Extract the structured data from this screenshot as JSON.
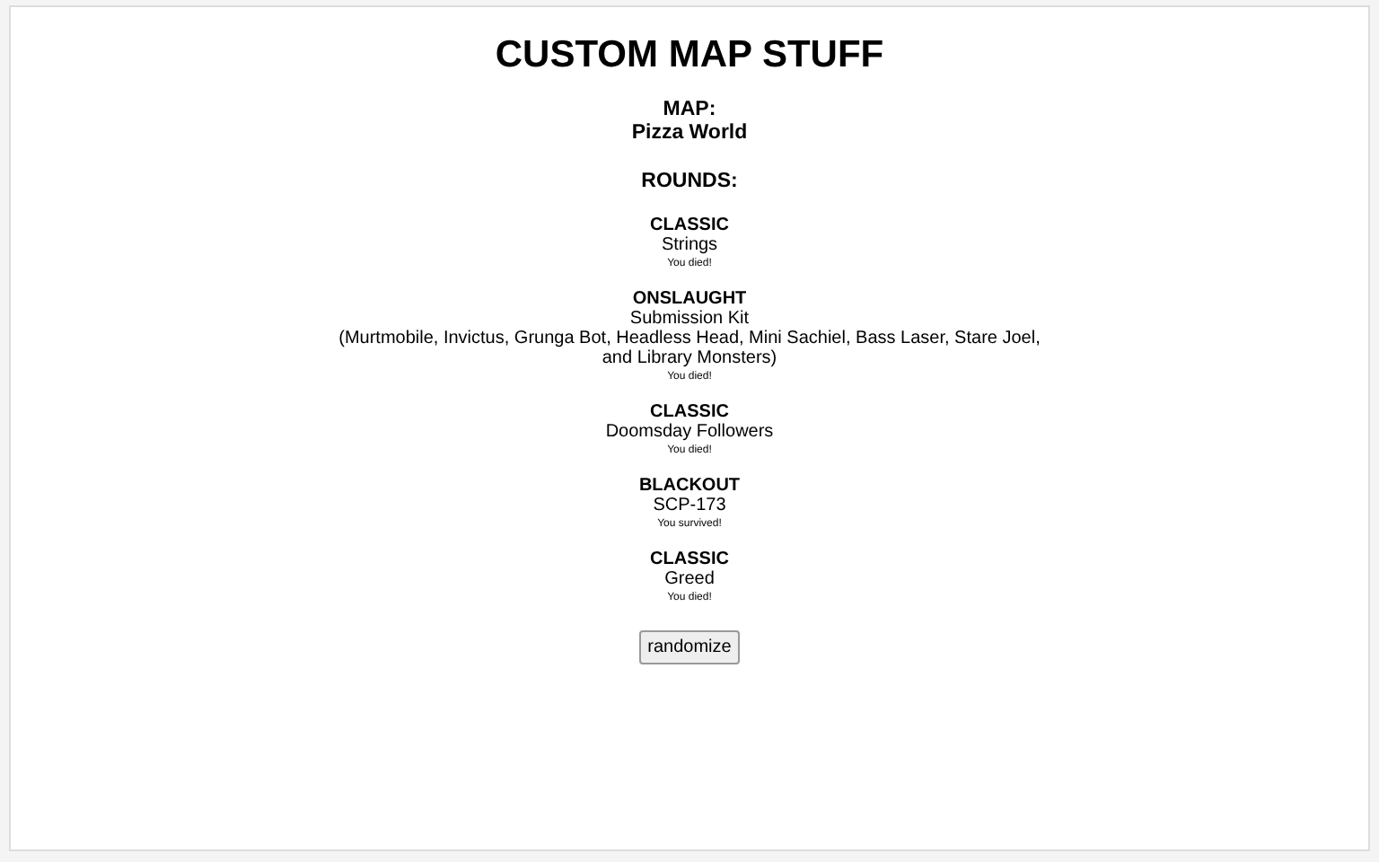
{
  "title": "CUSTOM MAP STUFF",
  "map": {
    "label": "MAP:",
    "value": "Pizza World"
  },
  "rounds_label": "ROUNDS:",
  "rounds": [
    {
      "mode": "CLASSIC",
      "enemy": "Strings",
      "result": "You died!"
    },
    {
      "mode": "ONSLAUGHT",
      "enemy": "Submission Kit",
      "detail": "(Murtmobile, Invictus, Grunga Bot, Headless Head, Mini Sachiel, Bass Laser, Stare Joel, and Library Monsters)",
      "result": "You died!"
    },
    {
      "mode": "CLASSIC",
      "enemy": "Doomsday Followers",
      "result": "You died!"
    },
    {
      "mode": "BLACKOUT",
      "enemy": "SCP-173",
      "result": "You survived!"
    },
    {
      "mode": "CLASSIC",
      "enemy": "Greed",
      "result": "You died!"
    }
  ],
  "button": "randomize"
}
